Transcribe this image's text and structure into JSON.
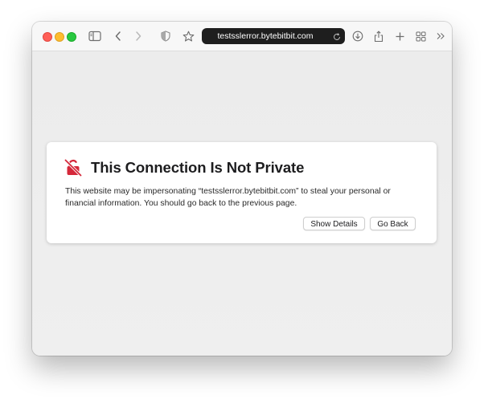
{
  "toolbar": {
    "address_text": "testsslerror.bytebitbit.com",
    "icons": [
      "sidebar-icon",
      "back-icon",
      "forward-icon",
      "privacy-shield-icon",
      "favorites-star-icon",
      "reload-icon",
      "downloads-icon",
      "share-icon",
      "new-tab-icon",
      "tab-overview-icon",
      "more-chevron-icon"
    ]
  },
  "warning": {
    "title": "This Connection Is Not Private",
    "message": "This website may be impersonating “testsslerror.bytebitbit.com” to steal your personal or financial information. You should go back to the previous page.",
    "show_details_label": "Show Details",
    "go_back_label": "Go Back",
    "icon": "broken-lock-icon",
    "accent_color": "#d5283a"
  },
  "traffic_lights": {
    "close_color": "#ff5f57",
    "minimize_color": "#febc2e",
    "zoom_color": "#28c840"
  }
}
